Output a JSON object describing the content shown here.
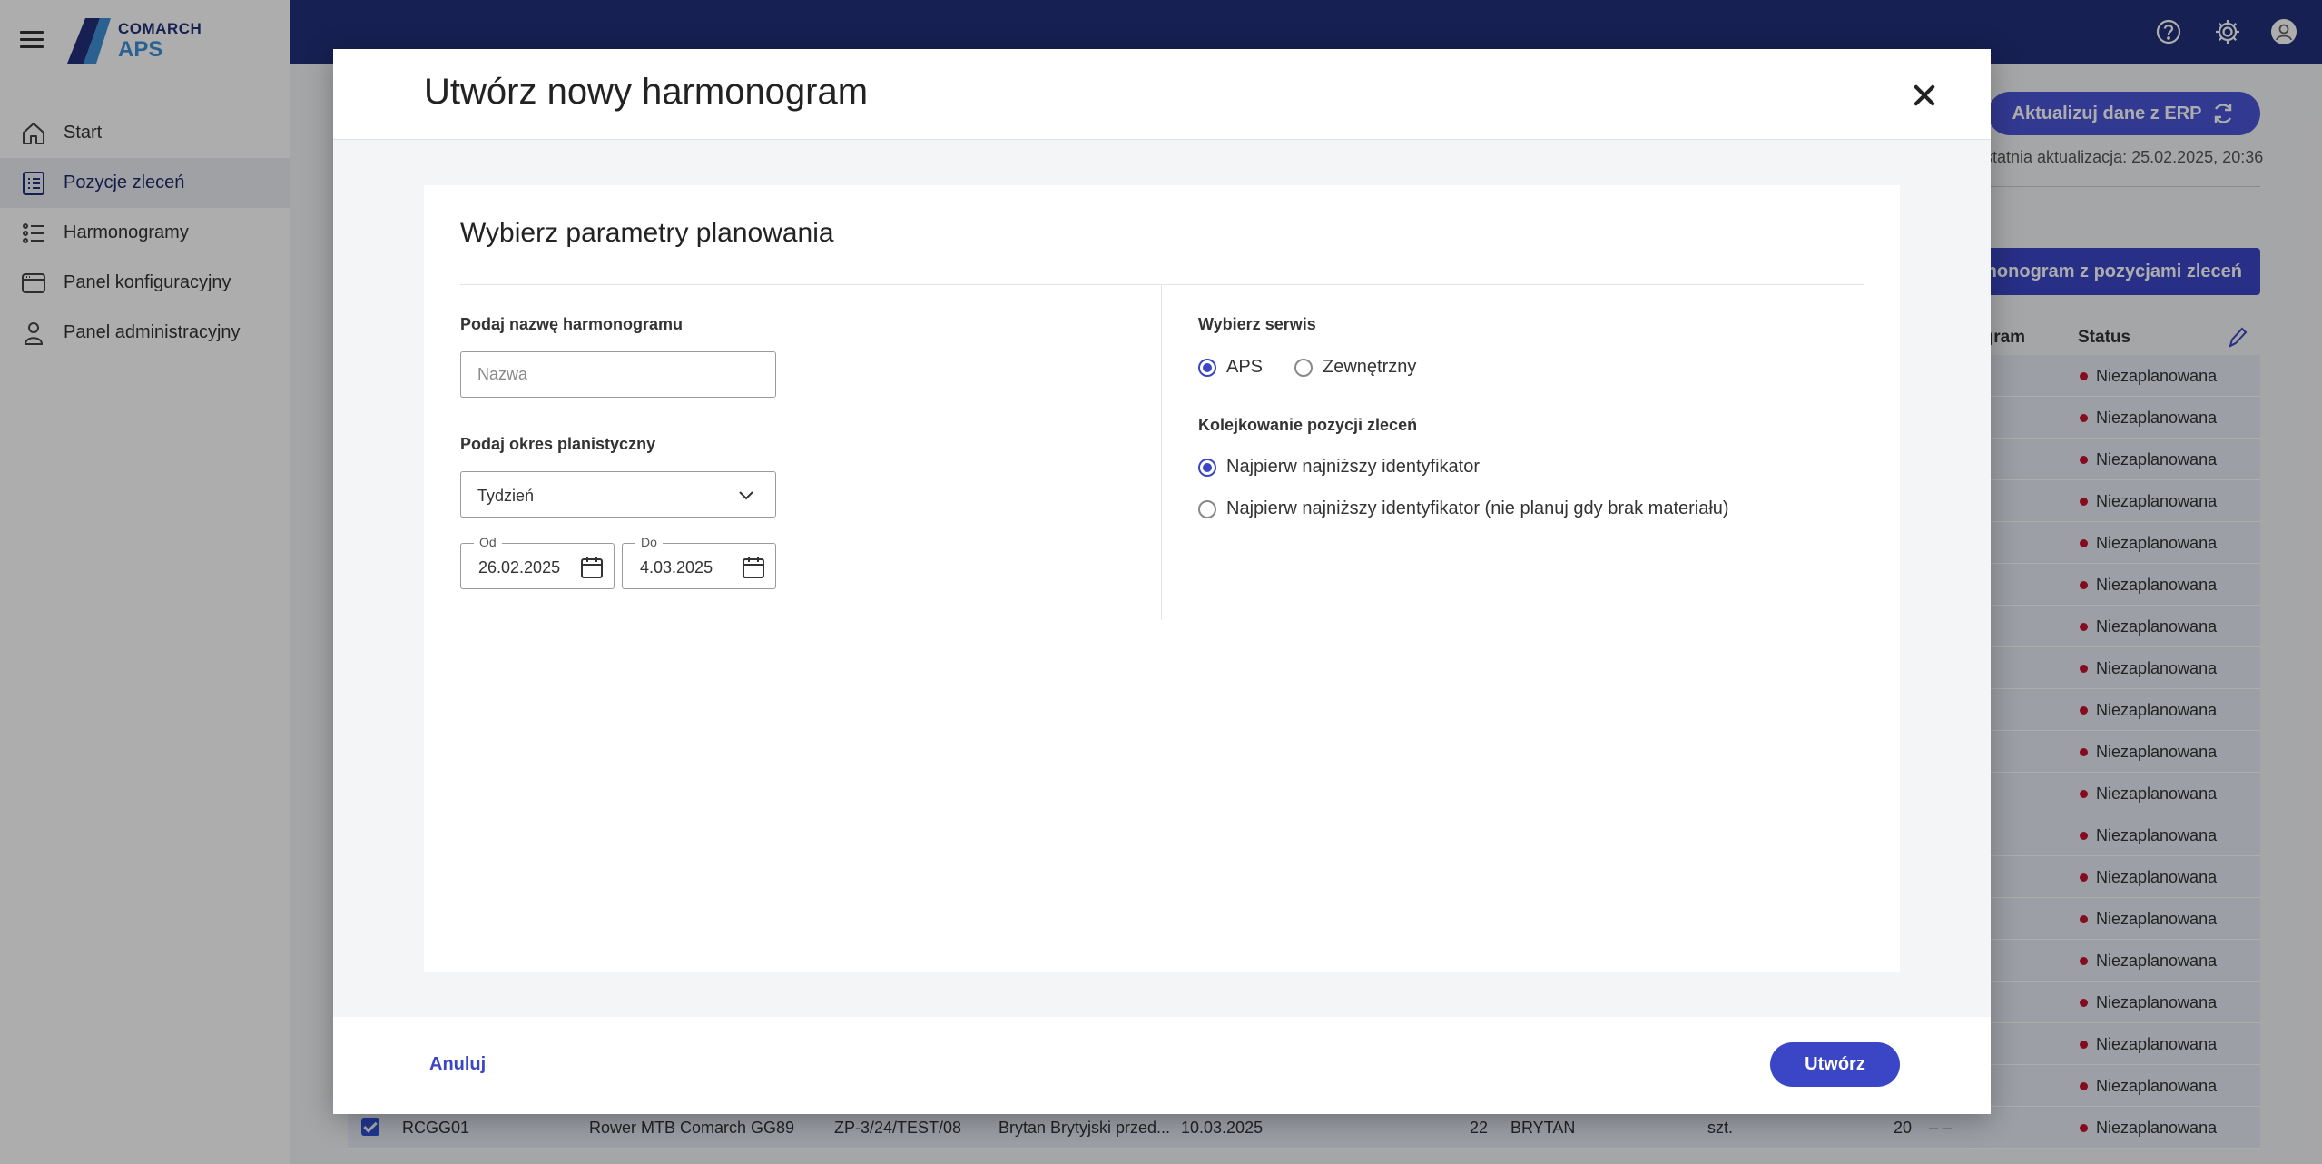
{
  "app": {
    "logo_line1": "COMARCH",
    "logo_line2": "APS"
  },
  "sidebar": {
    "items": [
      {
        "label": "Start",
        "icon": "home-icon",
        "active": false
      },
      {
        "label": "Pozycje zleceń",
        "icon": "list-doc-icon",
        "active": true
      },
      {
        "label": "Harmonogramy",
        "icon": "bullet-list-icon",
        "active": false
      },
      {
        "label": "Panel konfiguracyjny",
        "icon": "window-icon",
        "active": false
      },
      {
        "label": "Panel administracyjny",
        "icon": "person-icon",
        "active": false
      }
    ]
  },
  "topbar": {
    "icons": [
      "help-icon",
      "settings-icon",
      "user-avatar-icon"
    ]
  },
  "background": {
    "erp_button": "Aktualizuj dane z ERP",
    "last_update": "statnia aktualizacja: 25.02.2025, 20:36",
    "create_with_items_button": "monogram z pozycjami zleceń",
    "table_headers": {
      "harmonogram": "ogram",
      "status": "Status"
    },
    "status_text": "Niezaplanowana",
    "row_count": 19,
    "visible_row": {
      "code": "RCGG01",
      "name": "Rower MTB Comarch GG89",
      "order": "ZP-3/24/TEST/08",
      "customer": "Brytan Brytyjski przed...",
      "date": "10.03.2025",
      "qty": "22",
      "short": "BRYTAN",
      "unit": "szt.",
      "qty2": "20",
      "dash": "– –"
    }
  },
  "modal": {
    "title": "Utwórz nowy harmonogram",
    "card_title": "Wybierz parametry planowania",
    "name_label": "Podaj nazwę harmonogramu",
    "name_value": "",
    "name_placeholder": "Nazwa",
    "period_label": "Podaj okres planistyczny",
    "period_selected": "Tydzień",
    "date_from_label": "Od",
    "date_from_value": "26.02.2025",
    "date_to_label": "Do",
    "date_to_value": "4.03.2025",
    "service_label": "Wybierz serwis",
    "service_options": [
      {
        "label": "APS",
        "selected": true
      },
      {
        "label": "Zewnętrzny",
        "selected": false
      }
    ],
    "queue_label": "Kolejkowanie pozycji zleceń",
    "queue_options": [
      {
        "label": "Najpierw najniższy identyfikator",
        "selected": true
      },
      {
        "label": "Najpierw najniższy identyfikator (nie planuj gdy brak materiału)",
        "selected": false
      }
    ],
    "cancel_label": "Anuluj",
    "create_label": "Utwórz"
  },
  "colors": {
    "topbar": "#21307a",
    "accent": "#3a46c6",
    "status_dot": "#c4122f",
    "row_bg": "#e8eaf6"
  }
}
